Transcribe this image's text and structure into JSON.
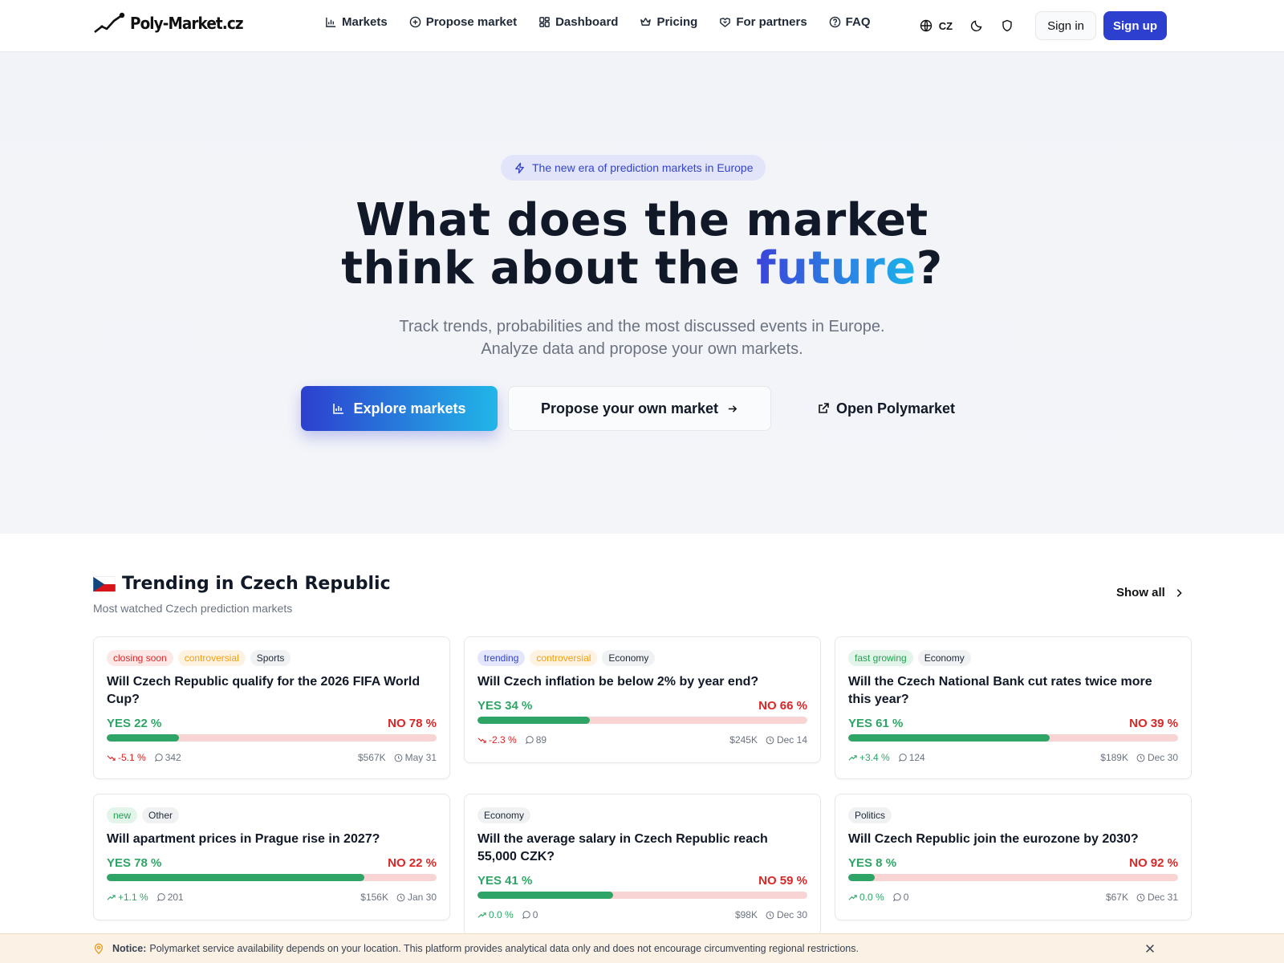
{
  "nav": {
    "logo_text": "Poly-Market.cz",
    "links": [
      "Markets",
      "Propose market",
      "Dashboard",
      "Pricing",
      "For partners",
      "FAQ"
    ],
    "language": "CZ",
    "sign_in": "Sign in",
    "sign_up": "Sign up"
  },
  "hero": {
    "badge": "The new era of prediction markets in Europe",
    "title_line1": "What does the market",
    "title_line2_prefix": "think about the ",
    "title_accent": "future",
    "title_suffix": "?",
    "subtitle_line1": "Track trends, probabilities and the most discussed events in Europe.",
    "subtitle_line2": "Analyze data and propose your own markets.",
    "btn_explore": "Explore markets",
    "btn_propose": "Propose your own market",
    "btn_polymarket": "Open Polymarket"
  },
  "trending": {
    "title": "Trending in Czech Republic",
    "subtitle": "Most watched Czech prediction markets",
    "show_all": "Show all"
  },
  "colors": {
    "primary": "#2d3fcf",
    "accent_cyan": "#1cb5ea",
    "yes": "#2ea566",
    "no": "#dc2626"
  },
  "markets": [
    {
      "tags": [
        {
          "text": "closing soon",
          "style": "red"
        },
        {
          "text": "controversial",
          "style": "orange"
        },
        {
          "text": "Sports",
          "style": "gray"
        }
      ],
      "title": "Will Czech Republic qualify for the 2026 FIFA World Cup?",
      "yes_label": "YES 22 %",
      "no_label": "NO 78 %",
      "yes_pct": 22,
      "change": "-5.1 %",
      "trend": "down",
      "comments": "342",
      "volume": "$567K",
      "date": "May 31"
    },
    {
      "tags": [
        {
          "text": "trending",
          "style": "blue"
        },
        {
          "text": "controversial",
          "style": "orange"
        },
        {
          "text": "Economy",
          "style": "gray"
        }
      ],
      "title": "Will Czech inflation be below 2% by year end?",
      "yes_label": "YES 34 %",
      "no_label": "NO 66 %",
      "yes_pct": 34,
      "change": "-2.3 %",
      "trend": "down",
      "comments": "89",
      "volume": "$245K",
      "date": "Dec 14"
    },
    {
      "tags": [
        {
          "text": "fast growing",
          "style": "green"
        },
        {
          "text": "Economy",
          "style": "gray"
        }
      ],
      "title": "Will the Czech National Bank cut rates twice more this year?",
      "yes_label": "YES 61 %",
      "no_label": "NO 39 %",
      "yes_pct": 61,
      "change": "+3.4 %",
      "trend": "up",
      "comments": "124",
      "volume": "$189K",
      "date": "Dec 30"
    },
    {
      "tags": [
        {
          "text": "new",
          "style": "green"
        },
        {
          "text": "Other",
          "style": "gray"
        }
      ],
      "title": "Will apartment prices in Prague rise in 2027?",
      "yes_label": "YES 78 %",
      "no_label": "NO 22 %",
      "yes_pct": 78,
      "change": "+1.1 %",
      "trend": "up",
      "comments": "201",
      "volume": "$156K",
      "date": "Jan 30"
    },
    {
      "tags": [
        {
          "text": "Economy",
          "style": "gray"
        }
      ],
      "title": "Will the average salary in Czech Republic reach 55,000 CZK?",
      "yes_label": "YES 41 %",
      "no_label": "NO 59 %",
      "yes_pct": 41,
      "change": "0.0 %",
      "trend": "up",
      "comments": "0",
      "volume": "$98K",
      "date": "Dec 30"
    },
    {
      "tags": [
        {
          "text": "Politics",
          "style": "gray"
        }
      ],
      "title": "Will Czech Republic join the eurozone by 2030?",
      "yes_label": "YES 8 %",
      "no_label": "NO 92 %",
      "yes_pct": 8,
      "change": "0.0 %",
      "trend": "up",
      "comments": "0",
      "volume": "$67K",
      "date": "Dec 31"
    }
  ],
  "notice": {
    "label": "Notice:",
    "text": "Polymarket service availability depends on your location. This platform provides analytical data only and does not encourage circumventing regional restrictions."
  },
  "icons": {
    "nav": [
      "bar-chart-icon",
      "plus-circle-icon",
      "dashboard-icon",
      "crown-icon",
      "handshake-icon",
      "help-circle-icon"
    ],
    "globe": "globe-icon",
    "theme": "moon-icon",
    "privacy": "shield-icon"
  }
}
